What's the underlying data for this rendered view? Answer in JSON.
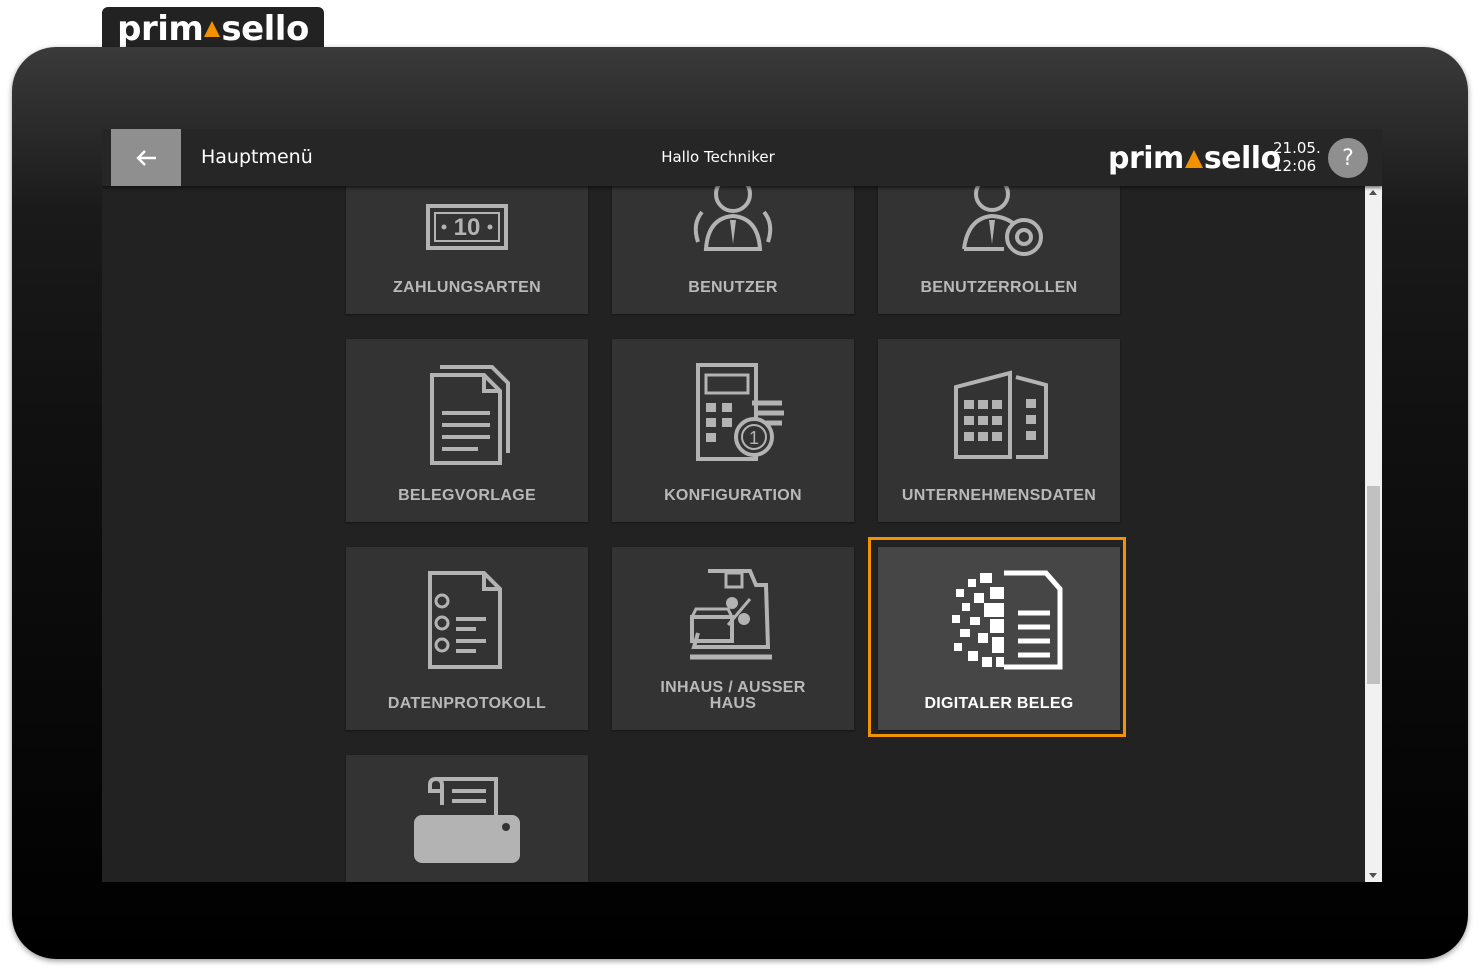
{
  "brand": {
    "logo_prefix": "prim",
    "logo_suffix": "sello"
  },
  "header": {
    "title": "Hauptmenü",
    "greeting": "Hallo Techniker",
    "date": "21.05.",
    "time": "12:06",
    "help_label": "?"
  },
  "tiles": [
    {
      "label": "ZAHLUNGSARTEN",
      "icon": "cash-icon"
    },
    {
      "label": "BENUTZER",
      "icon": "users-icon"
    },
    {
      "label": "BENUTZERROLLEN",
      "icon": "user-roles-icon"
    },
    {
      "label": "BELEGVORLAGE",
      "icon": "documents-icon"
    },
    {
      "label": "KONFIGURATION",
      "icon": "calculator-icon"
    },
    {
      "label": "UNTERNEHMENSDATEN",
      "icon": "buildings-icon"
    },
    {
      "label": "DATENPROTOKOLL",
      "icon": "checklist-document-icon"
    },
    {
      "label_line1": "INHAUS / AUSSER",
      "label_line2": "HAUS",
      "icon": "takeaway-icon"
    },
    {
      "label": "DIGITALER BELEG",
      "icon": "digital-receipt-icon",
      "selected": true
    },
    {
      "label": "",
      "icon": "printer-icon"
    }
  ],
  "colors": {
    "accent": "#f39200",
    "tile": "#333333",
    "tile_selected": "#464646",
    "screen": "#222222"
  }
}
